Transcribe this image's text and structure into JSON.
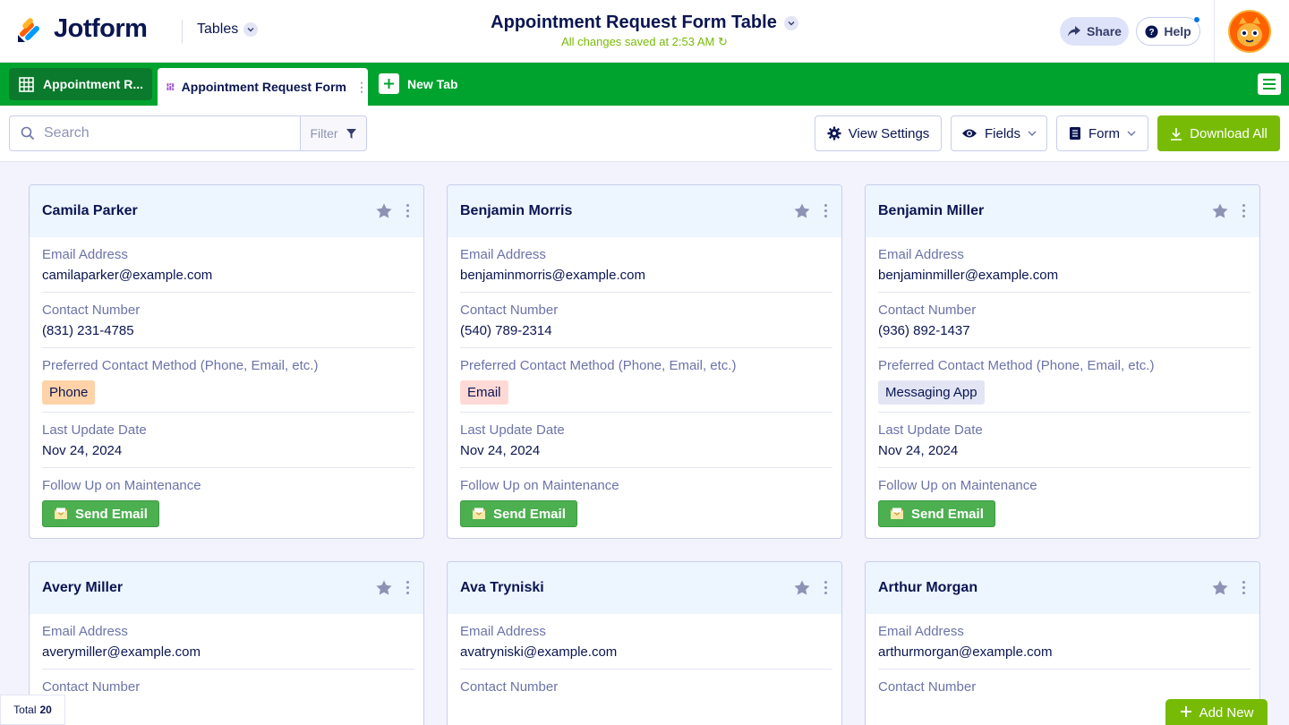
{
  "header": {
    "brand": "Jotform",
    "product_dropdown": "Tables",
    "title": "Appointment Request Form Table",
    "saved_status": "All changes saved at 2:53 AM",
    "share_label": "Share",
    "help_label": "Help"
  },
  "tabs": {
    "tab1_label": "Appointment R...",
    "tab2_label": "Appointment Request Form",
    "new_tab_label": "New Tab"
  },
  "toolbar": {
    "search_placeholder": "Search",
    "filter_label": "Filter",
    "view_settings_label": "View Settings",
    "fields_label": "Fields",
    "form_label": "Form",
    "download_label": "Download All"
  },
  "field_labels": {
    "email": "Email Address",
    "contact": "Contact Number",
    "preferred": "Preferred Contact Method (Phone, Email, etc.)",
    "last_update": "Last Update Date",
    "follow_up": "Follow Up on Maintenance",
    "send_email": "Send Email"
  },
  "cards": [
    {
      "name": "Camila Parker",
      "email": "camilaparker@example.com",
      "contact": "(831) 231-4785",
      "preferred": "Phone",
      "last_update": "Nov 24, 2024"
    },
    {
      "name": "Benjamin Morris",
      "email": "benjaminmorris@example.com",
      "contact": "(540) 789-2314",
      "preferred": "Email",
      "last_update": "Nov 24, 2024"
    },
    {
      "name": "Benjamin Miller",
      "email": "benjaminmiller@example.com",
      "contact": "(936) 892-1437",
      "preferred": "Messaging App",
      "last_update": "Nov 24, 2024"
    },
    {
      "name": "Avery Miller",
      "email": "averymiller@example.com"
    },
    {
      "name": "Ava Tryniski",
      "email": "avatryniski@example.com"
    },
    {
      "name": "Arthur Morgan",
      "email": "arthurmorgan@example.com"
    }
  ],
  "pill_colors": {
    "Phone": "#ffd2a8",
    "Email": "#ffd9d6",
    "Messaging App": "#e3e5f5"
  },
  "footer": {
    "total_label": "Total",
    "total_count": "20",
    "add_new_label": "Add New"
  },
  "colors": {
    "brand_green": "#01a32f",
    "accent_lime": "#78bb07",
    "send_green": "#4caf50"
  }
}
